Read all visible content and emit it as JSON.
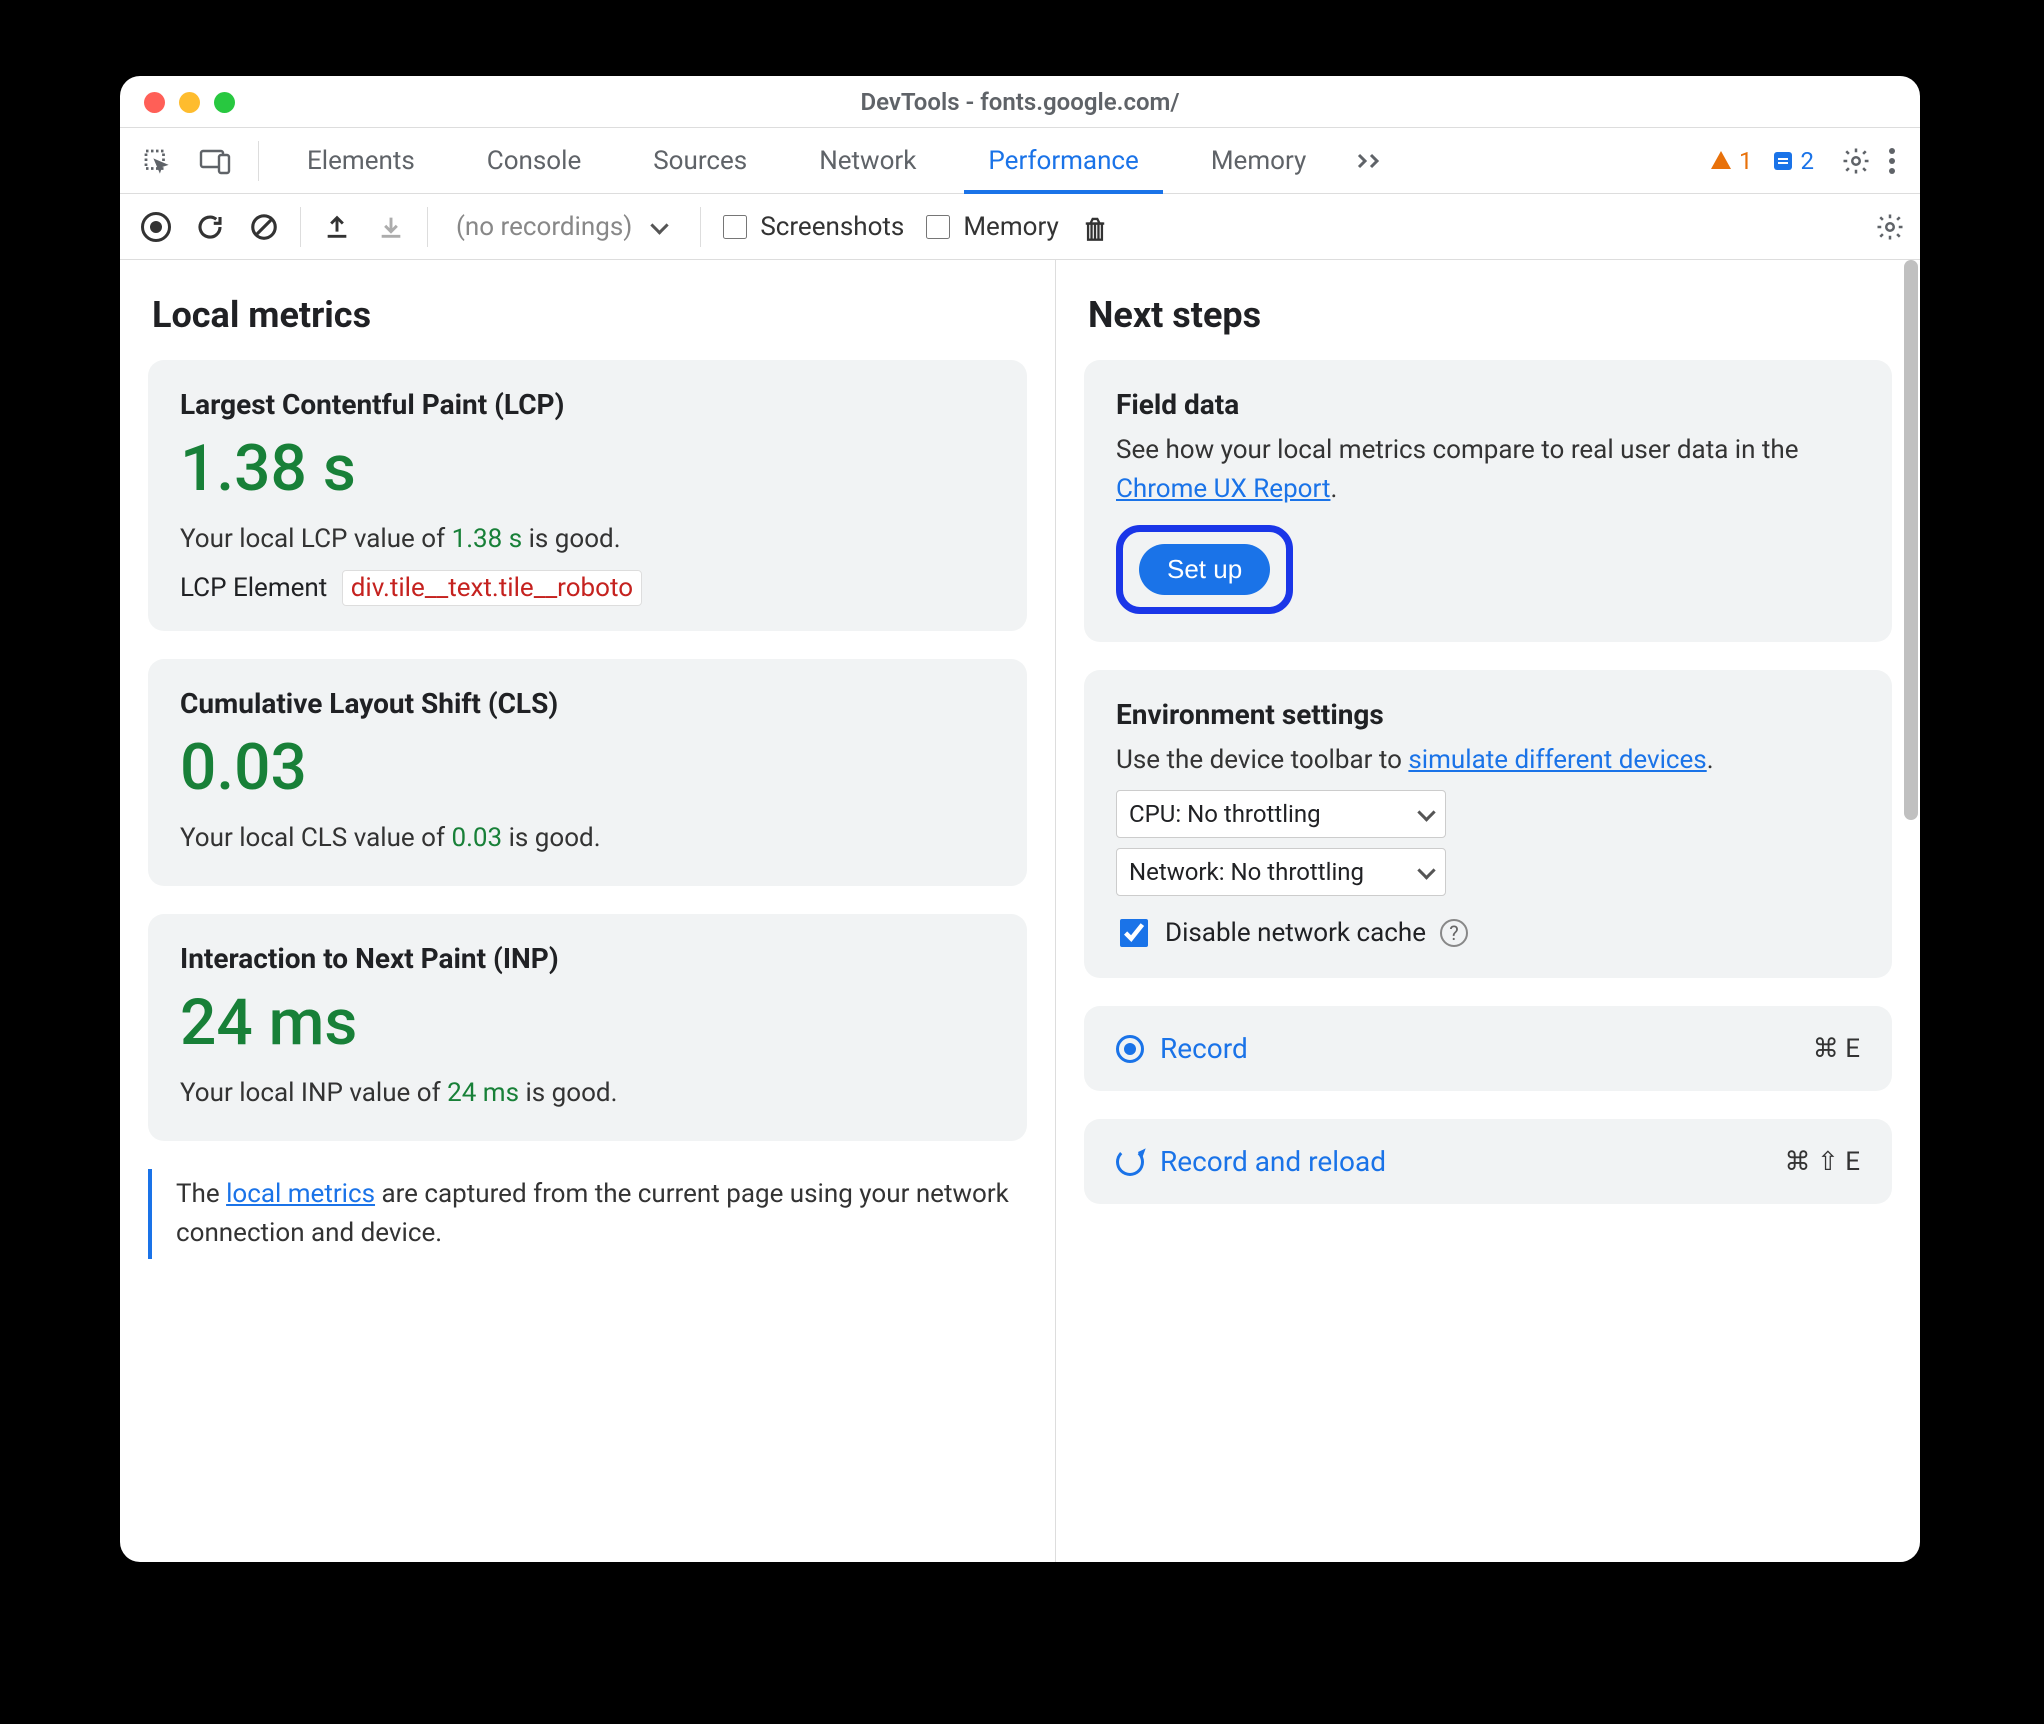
{
  "window": {
    "title": "DevTools - fonts.google.com/"
  },
  "tabs": {
    "items": [
      "Elements",
      "Console",
      "Sources",
      "Network",
      "Performance",
      "Memory"
    ],
    "active": 4,
    "warn_count": "1",
    "info_count": "2"
  },
  "toolbar": {
    "no_recordings": "(no recordings)",
    "screenshots_label": "Screenshots",
    "memory_label": "Memory"
  },
  "left": {
    "heading": "Local metrics",
    "lcp": {
      "title": "Largest Contentful Paint (LCP)",
      "value": "1.38 s",
      "desc_pre": "Your local LCP value of ",
      "desc_val": "1.38 s",
      "desc_post": " is good.",
      "element_label": "LCP Element",
      "element_sel": "div.tile__text.tile__roboto"
    },
    "cls": {
      "title": "Cumulative Layout Shift (CLS)",
      "value": "0.03",
      "desc_pre": "Your local CLS value of ",
      "desc_val": "0.03",
      "desc_post": " is good."
    },
    "inp": {
      "title": "Interaction to Next Paint (INP)",
      "value": "24 ms",
      "desc_pre": "Your local INP value of ",
      "desc_val": "24 ms",
      "desc_post": " is good."
    },
    "footer_pre": "The ",
    "footer_link": "local metrics",
    "footer_post": " are captured from the current page using your network connection and device."
  },
  "right": {
    "heading": "Next steps",
    "field": {
      "title": "Field data",
      "desc_pre": "See how your local metrics compare to real user data in the ",
      "desc_link": "Chrome UX Report",
      "desc_post": ".",
      "setup_label": "Set up"
    },
    "env": {
      "title": "Environment settings",
      "desc_pre": "Use the device toolbar to ",
      "desc_link": "simulate different devices",
      "desc_post": ".",
      "cpu": "CPU: No throttling",
      "net": "Network: No throttling",
      "disable_cache": "Disable network cache"
    },
    "record": {
      "label": "Record",
      "shortcut": "⌘ E"
    },
    "reload": {
      "label": "Record and reload",
      "shortcut": "⌘ ⇧ E"
    }
  }
}
